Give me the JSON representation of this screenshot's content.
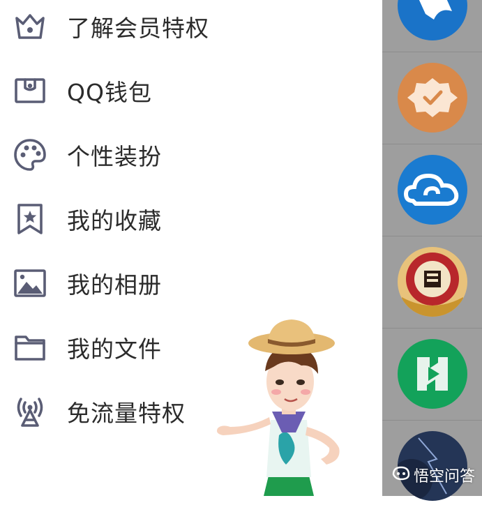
{
  "menu": {
    "items": [
      {
        "label": "了解会员特权",
        "icon": "crown-icon"
      },
      {
        "label": "QQ钱包",
        "icon": "wallet-icon"
      },
      {
        "label": "个性装扮",
        "icon": "palette-icon"
      },
      {
        "label": "我的收藏",
        "icon": "bookmark-star-icon"
      },
      {
        "label": "我的相册",
        "icon": "photo-icon"
      },
      {
        "label": "我的文件",
        "icon": "folder-icon"
      },
      {
        "label": "免流量特权",
        "icon": "broadcast-icon"
      }
    ]
  },
  "side_apps": [
    {
      "icon": "blue-bird-icon",
      "color": "#1a73c8"
    },
    {
      "icon": "badge-check-icon",
      "color": "#d9894a"
    },
    {
      "icon": "cloud-icon",
      "color": "#1a7bd0"
    },
    {
      "icon": "red-gold-emblem-icon",
      "color": "#b8272b"
    },
    {
      "icon": "green-n-play-icon",
      "color": "#13a25a"
    },
    {
      "icon": "night-sky-icon",
      "color": "#243556"
    }
  ],
  "colors": {
    "icon": "#5a5d75",
    "overlay": "#9e9e9e"
  },
  "watermark": {
    "text": "悟空问答"
  }
}
